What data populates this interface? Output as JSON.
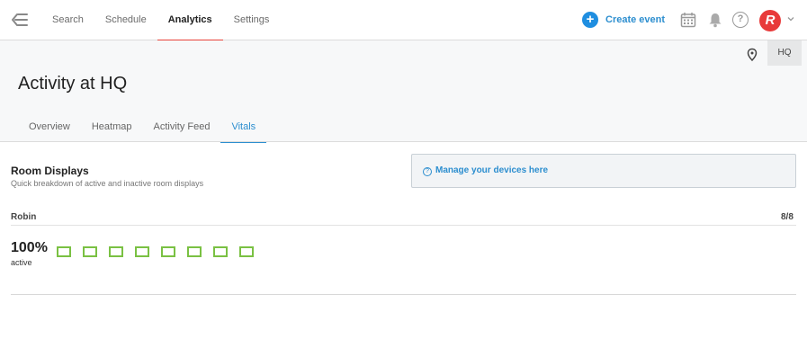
{
  "nav": {
    "items": [
      {
        "label": "Search"
      },
      {
        "label": "Schedule"
      },
      {
        "label": "Analytics"
      },
      {
        "label": "Settings"
      }
    ],
    "active_index": 2
  },
  "toolbar": {
    "create_event_label": "Create event",
    "avatar_letter": "R",
    "help_glyph": "?",
    "plus_glyph": "+"
  },
  "icons": [
    "collapse-icon",
    "plus-circle-icon",
    "calendar-icon",
    "bell-icon",
    "help-icon",
    "chevron-down-icon",
    "location-pin-icon",
    "info-icon"
  ],
  "colors": {
    "accent_red": "#e8433a",
    "link_blue": "#2c8ecf",
    "active_green": "#7ac143",
    "create_blue": "#1f8ee0"
  },
  "location": {
    "badge": "HQ"
  },
  "page": {
    "title": "Activity at HQ",
    "tabs": [
      {
        "label": "Overview"
      },
      {
        "label": "Heatmap"
      },
      {
        "label": "Activity Feed"
      },
      {
        "label": "Vitals"
      }
    ],
    "active_tab_index": 3
  },
  "room_displays": {
    "title": "Room Displays",
    "subtitle": "Quick breakdown of active and inactive room displays",
    "manage_link": "Manage your devices here",
    "info_glyph": "?",
    "group": {
      "name": "Robin",
      "count": "8/8",
      "percent": "100%",
      "status_label": "active",
      "active_fraction": 1.0,
      "displays": [
        {
          "state": "active"
        },
        {
          "state": "active"
        },
        {
          "state": "active"
        },
        {
          "state": "active"
        },
        {
          "state": "active"
        },
        {
          "state": "active"
        },
        {
          "state": "active"
        },
        {
          "state": "active"
        }
      ]
    }
  }
}
